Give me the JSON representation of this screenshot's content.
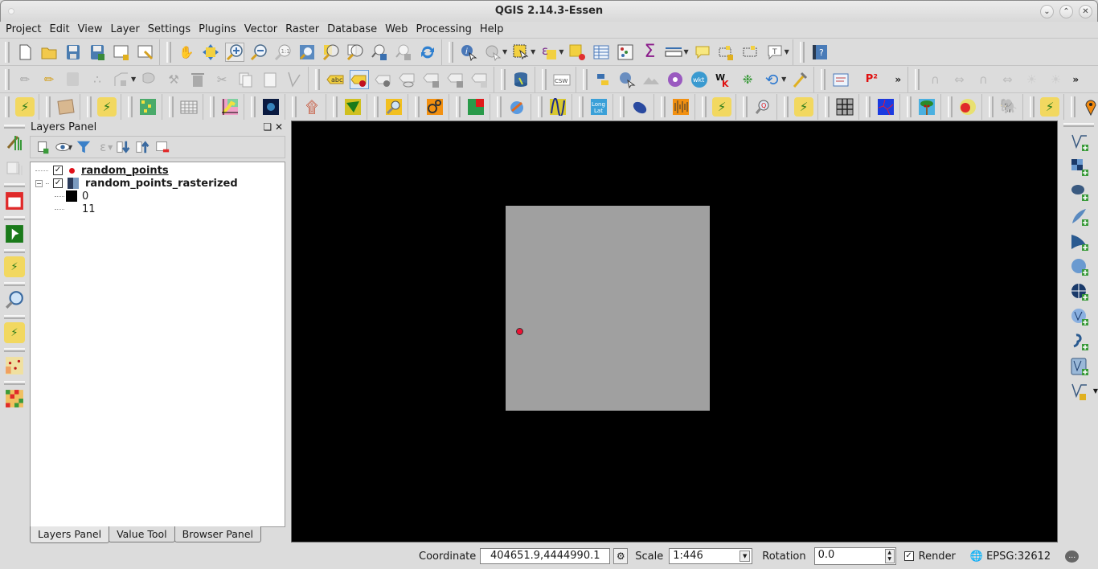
{
  "window": {
    "title": "QGIS 2.14.3-Essen"
  },
  "menubar": [
    "Project",
    "Edit",
    "View",
    "Layer",
    "Settings",
    "Plugins",
    "Vector",
    "Raster",
    "Database",
    "Web",
    "Processing",
    "Help"
  ],
  "toolbar_icons": {
    "row1": [
      "new-project",
      "open-project",
      "save-project",
      "save-project-as",
      "new-print-composer",
      "composer-manager",
      "pan",
      "pan-to-selection",
      "zoom-in",
      "zoom-out",
      "zoom-native",
      "zoom-full",
      "zoom-to-selection",
      "zoom-to-layer",
      "zoom-last",
      "zoom-next",
      "refresh",
      "identify",
      "run-action",
      "select-features",
      "select-by-expression",
      "deselect",
      "attribute-table",
      "field-calculator",
      "statistical-summary",
      "measure",
      "map-tips",
      "new-bookmark",
      "show-bookmarks",
      "text-annotation",
      "help"
    ],
    "row2": [
      "current-edits",
      "toggle-editing",
      "save-edits",
      "add-feature",
      "vertex-tool",
      "move-feature",
      "node-tool",
      "delete-selected",
      "cut-features",
      "copy-features",
      "paste-features",
      "digitize",
      "label",
      "pin-labels",
      "show-hide-labels",
      "preview-labels",
      "move-label",
      "rotate-label",
      "change-label",
      "db-manager",
      "csw",
      "python-console",
      "identify-plugin",
      "terrain",
      "plugin-settings",
      "wkt",
      "wkt-tools",
      "bug",
      "undo",
      "tool-build",
      "composer-report",
      "p2-plugin",
      "more",
      "histogram",
      "flow",
      "histogram2",
      "flow2",
      "brightness-up",
      "brightness-down",
      "more"
    ],
    "row3": [
      "plugin",
      "map-tour",
      "plugin",
      "grid",
      "table-calc",
      "raster-graph",
      "wormhole",
      "spiral",
      "satellite",
      "search",
      "processing",
      "qgis-cloud",
      "rgb",
      "sine",
      "long-lat",
      "mouse",
      "sound",
      "plugin",
      "sql",
      "plugin",
      "georeferencer",
      "network",
      "palm",
      "heatmap",
      "postgis-elephant",
      "plugin",
      "marker",
      "network"
    ]
  },
  "layers_panel": {
    "title": "Layers Panel",
    "layers": [
      {
        "name": "random_points",
        "checked": true,
        "symbol": "red-dot",
        "bold": true,
        "underline": true
      },
      {
        "name": "random_points_rasterized",
        "checked": true,
        "symbol": "raster",
        "expanded": true,
        "legend": [
          {
            "label": "0",
            "color": "#000000"
          },
          {
            "label": "11",
            "color": "#ffffff"
          }
        ]
      }
    ],
    "tabs": [
      "Layers Panel",
      "Value Tool",
      "Browser Panel"
    ],
    "active_tab": "Layers Panel"
  },
  "map": {
    "background": "#000000",
    "raster_color": "#a0a0a0",
    "point_color": "#ee1133"
  },
  "statusbar": {
    "coordinate_label": "Coordinate",
    "coordinate_value": "404651.9,4444990.1",
    "scale_label": "Scale",
    "scale_value": "1:446",
    "rotation_label": "Rotation",
    "rotation_value": "0.0",
    "render_label": "Render",
    "render_checked": true,
    "crs": "EPSG:32612"
  }
}
